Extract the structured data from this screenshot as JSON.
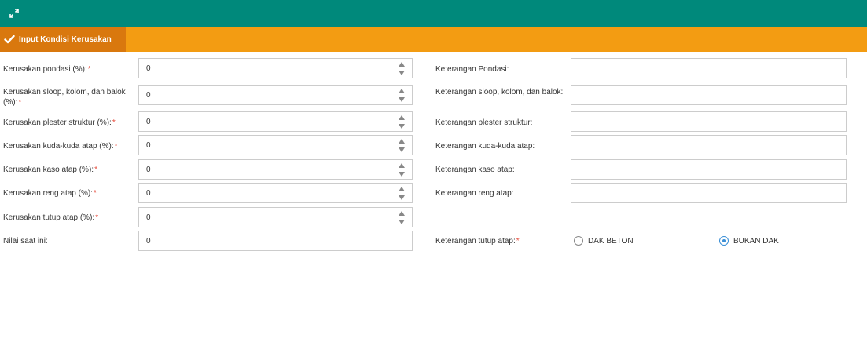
{
  "header": {
    "expand_icon": "expand-icon",
    "bg_color": "#00897b"
  },
  "tabs": [
    {
      "label": "Input Kondisi Kerusakan",
      "icon": "check-icon",
      "active": true
    }
  ],
  "left_fields": [
    {
      "label": "Kerusakan pondasi (%):",
      "required": "*",
      "value": "0"
    },
    {
      "label": "Kerusakan sloop, kolom, dan balok (%):",
      "required": "*",
      "value": "0"
    },
    {
      "label": "Kerusakan plester struktur (%):",
      "required": "*",
      "value": "0"
    },
    {
      "label": "Kerusakan kuda-kuda atap (%):",
      "required": "*",
      "value": "0"
    },
    {
      "label": "Kerusakan kaso atap (%):",
      "required": "*",
      "value": "0"
    },
    {
      "label": "Kerusakan reng atap (%):",
      "required": "*",
      "value": "0"
    },
    {
      "label": "Kerusakan tutup atap (%):",
      "required": "*",
      "value": "0"
    },
    {
      "label": "Nilai saat ini:",
      "value": "0"
    }
  ],
  "right_fields": [
    {
      "label": "Keterangan Pondasi:",
      "value": ""
    },
    {
      "label": "Keterangan sloop, kolom, dan balok:",
      "value": ""
    },
    {
      "label": "Keterangan plester struktur:",
      "value": ""
    },
    {
      "label": "Keterangan kuda-kuda atap:",
      "value": ""
    },
    {
      "label": "Keterangan kaso atap:",
      "value": ""
    },
    {
      "label": "Keterangan reng atap:",
      "value": ""
    }
  ],
  "tutup_atap": {
    "label": "Keterangan tutup atap:",
    "required": "*",
    "options": [
      {
        "label": "DAK BETON",
        "checked": false
      },
      {
        "label": "BUKAN DAK",
        "checked": true
      }
    ]
  },
  "colors": {
    "accent_orange": "#f39c12",
    "active_tab": "#d9780e",
    "required": "#e74c3c",
    "radio_checked": "#3a8fd6"
  }
}
